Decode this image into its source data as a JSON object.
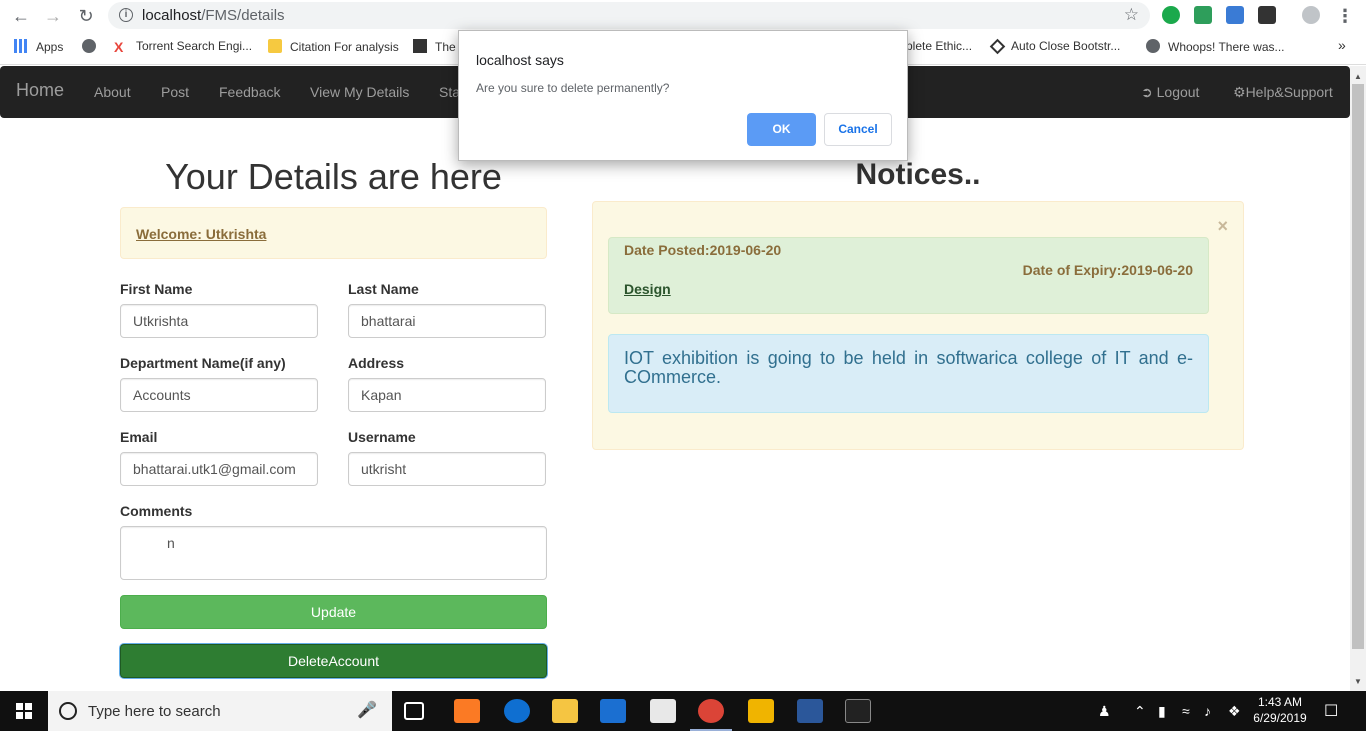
{
  "browser": {
    "url_host": "localhost",
    "url_path": "/FMS/details",
    "bookmarks": [
      {
        "label": "Apps",
        "color": "#4285f4"
      },
      {
        "label": "",
        "color": "#5f6368"
      },
      {
        "label": "Torrent Search Engi...",
        "color": "#e8453c"
      },
      {
        "label": "Citation For analysis",
        "color": "#f6c940"
      },
      {
        "label": "The",
        "color": "#333333"
      },
      {
        "label": "plete Ethic...",
        "color": "#5f6368"
      },
      {
        "label": "Auto Close Bootstr...",
        "color": "#333333"
      },
      {
        "label": "Whoops! There was...",
        "color": "#5f6368"
      }
    ],
    "more_bookmarks": "»"
  },
  "navbar": {
    "brand": "Home",
    "items": [
      "About",
      "Post",
      "Feedback",
      "View My Details",
      "Sta"
    ],
    "logout": "Logout",
    "help": "Help&Support"
  },
  "details": {
    "title": "Your Details are here",
    "welcome": "Welcome: Utkrishta",
    "first_name_label": "First Name",
    "first_name": "Utkrishta",
    "last_name_label": "Last Name",
    "last_name": "bhattarai",
    "department_label": "Department Name(if any)",
    "department": "Accounts",
    "address_label": "Address",
    "address": "Kapan",
    "email_label": "Email",
    "email": "bhattarai.utk1@gmail.com",
    "username_label": "Username",
    "username": "utkrisht",
    "comments_label": "Comments",
    "comments": "n",
    "update_label": "Update",
    "delete_label": "DeleteAccount"
  },
  "notices": {
    "title": "Notices..",
    "close": "×",
    "date_posted": "Date Posted:2019-06-20",
    "date_expiry": "Date of Expiry:2019-06-20",
    "category": "Design",
    "message": "IOT exhibition is going to be held in softwarica college of IT and e-COmmerce."
  },
  "dialog": {
    "title": "localhost says",
    "message": "Are you sure to delete permanently?",
    "ok_label": "OK",
    "cancel_label": "Cancel"
  },
  "taskbar": {
    "search_placeholder": "Type here to search",
    "time": "1:43 AM",
    "date": "6/29/2019"
  }
}
